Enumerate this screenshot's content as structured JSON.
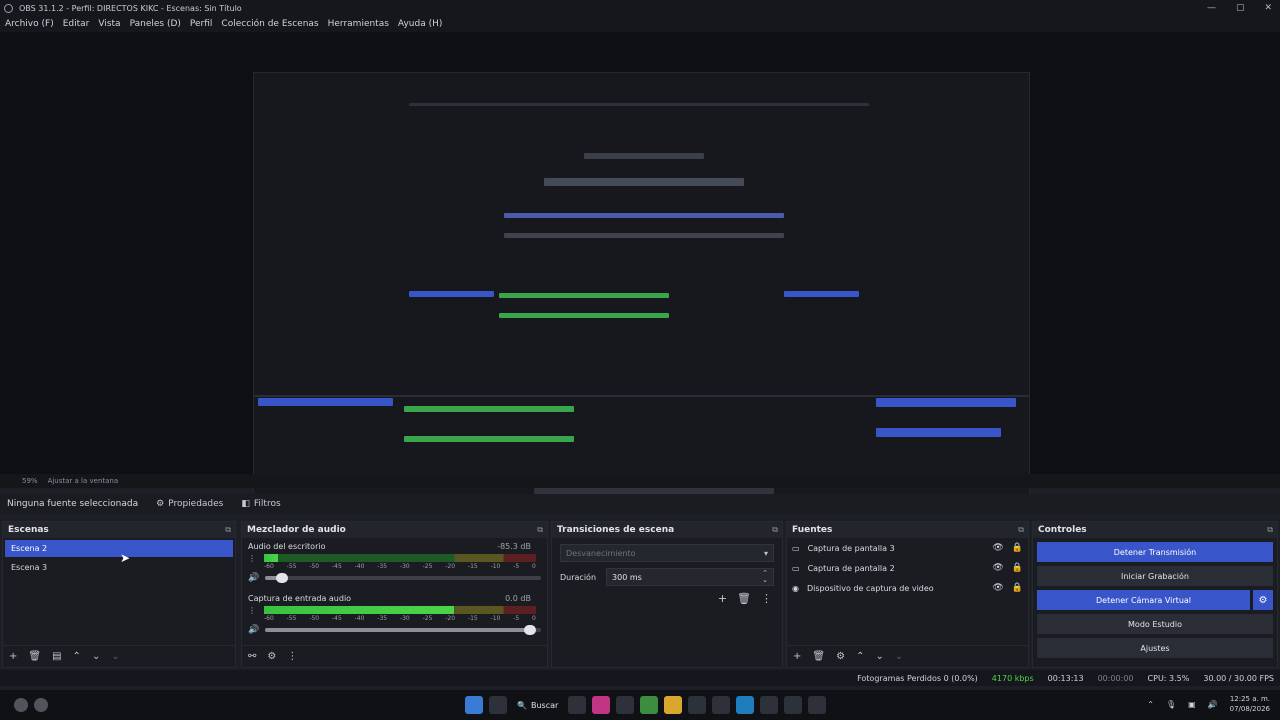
{
  "window": {
    "title": "OBS 31.1.2 - Perfil: DIRECTOS KIKC - Escenas: Sin Título",
    "controls": [
      "—",
      "▢",
      "✕"
    ]
  },
  "menu": [
    "Archivo (F)",
    "Editar",
    "Vista",
    "Paneles (D)",
    "Perfil",
    "Colección de Escenas",
    "Herramientas",
    "Ayuda (H)"
  ],
  "zoom": {
    "level": "59%",
    "fit": "Ajustar a la ventana"
  },
  "source_toolbar": {
    "info": "Ninguna fuente seleccionada",
    "properties": "Propiedades",
    "filters": "Filtros"
  },
  "scenes": {
    "title": "Escenas",
    "items": [
      {
        "label": "Escena 2",
        "active": true
      },
      {
        "label": "Escena 3",
        "active": false
      }
    ]
  },
  "mixer": {
    "title": "Mezclador de audio",
    "channels": [
      {
        "name": "Audio del escritorio",
        "db": "-85.3 dB",
        "level": 0.05,
        "volume": 0.06
      },
      {
        "name": "Captura de entrada audio",
        "db": "0.0 dB",
        "level": 0.7,
        "volume": 0.96
      }
    ],
    "ticks": [
      "-60",
      "-55",
      "-50",
      "-45",
      "-40",
      "-35",
      "-30",
      "-25",
      "-20",
      "-15",
      "-10",
      "-5",
      "0"
    ]
  },
  "transitions": {
    "title": "Transiciones de escena",
    "selected": "Desvanecimiento",
    "duration_label": "Duración",
    "duration_value": "300 ms"
  },
  "sources": {
    "title": "Fuentes",
    "items": [
      {
        "label": "Captura de pantalla 3",
        "icon": "monitor-icon"
      },
      {
        "label": "Captura de pantalla 2",
        "icon": "monitor-icon"
      },
      {
        "label": "Dispositivo de captura de video",
        "icon": "camera-icon"
      }
    ]
  },
  "controls": {
    "title": "Controles",
    "stop_stream": "Detener Transmisión",
    "start_record": "Iniciar Grabación",
    "stop_virtualcam": "Detener Cámara Virtual",
    "studio_mode": "Modo Estudio",
    "settings": "Ajustes"
  },
  "status": {
    "dropped": "Fotogramas Perdidos 0 (0.0%)",
    "bitrate": "4170 kbps",
    "stream_time": "00:13:13",
    "record_time": "00:00:00",
    "cpu": "CPU: 3.5%",
    "fps": "30.00 / 30.00 FPS"
  },
  "taskbar": {
    "search": "Buscar",
    "time": "12:25 a. m.",
    "date": "07/08/2026"
  },
  "colors": {
    "accent": "#3856c9",
    "meter_green": "#4bd54a",
    "background": "#1d1f26"
  }
}
